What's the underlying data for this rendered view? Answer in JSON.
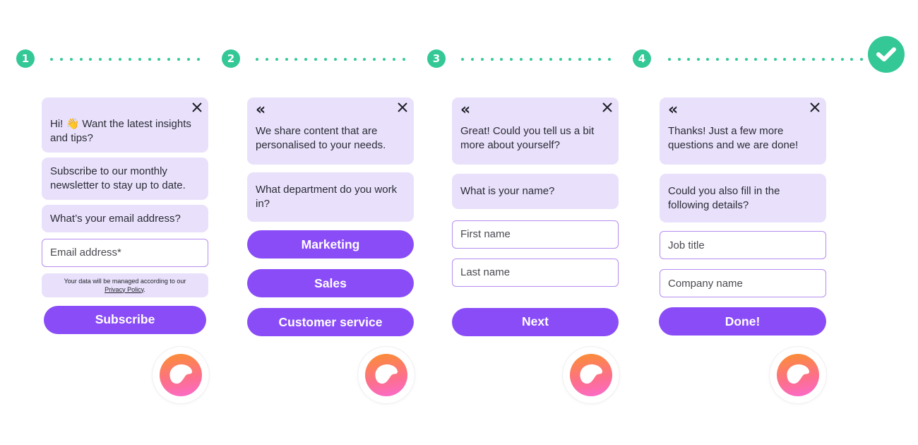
{
  "stepper": {
    "steps": [
      "1",
      "2",
      "3",
      "4"
    ],
    "complete_icon": "check-icon",
    "color": "#34c896"
  },
  "theme": {
    "accent": "#8a4cf7",
    "bubble_bg": "#e9e1fb",
    "field_border": "#b68cf0"
  },
  "panels": [
    {
      "step": "1",
      "greeting": "Hi! 👋 Want the latest insights and tips?",
      "messages": [
        "Subscribe to our monthly newsletter to stay up to date.",
        "What’s your email address?"
      ],
      "email_placeholder": "Email address*",
      "policy_text": "Your data will be managed according to our",
      "policy_link": "Privacy Policy",
      "policy_end": ".",
      "button": "Subscribe"
    },
    {
      "step": "2",
      "greeting": "We share content that are personalised to your needs.",
      "messages": [
        "What department do you work in?"
      ],
      "options": [
        "Marketing",
        "Sales",
        "Customer service"
      ]
    },
    {
      "step": "3",
      "greeting": "Great! Could you tell us a bit more about yourself?",
      "messages": [
        "What is your name?"
      ],
      "fields": [
        "First name",
        "Last name"
      ],
      "button": "Next"
    },
    {
      "step": "4",
      "greeting": "Thanks! Just a few more questions and we are done!",
      "messages": [
        "Could you also fill in the following details?"
      ],
      "fields": [
        "Job title",
        "Company name"
      ],
      "button": "Done!"
    }
  ],
  "icons": {
    "close": "×",
    "back": "«"
  }
}
